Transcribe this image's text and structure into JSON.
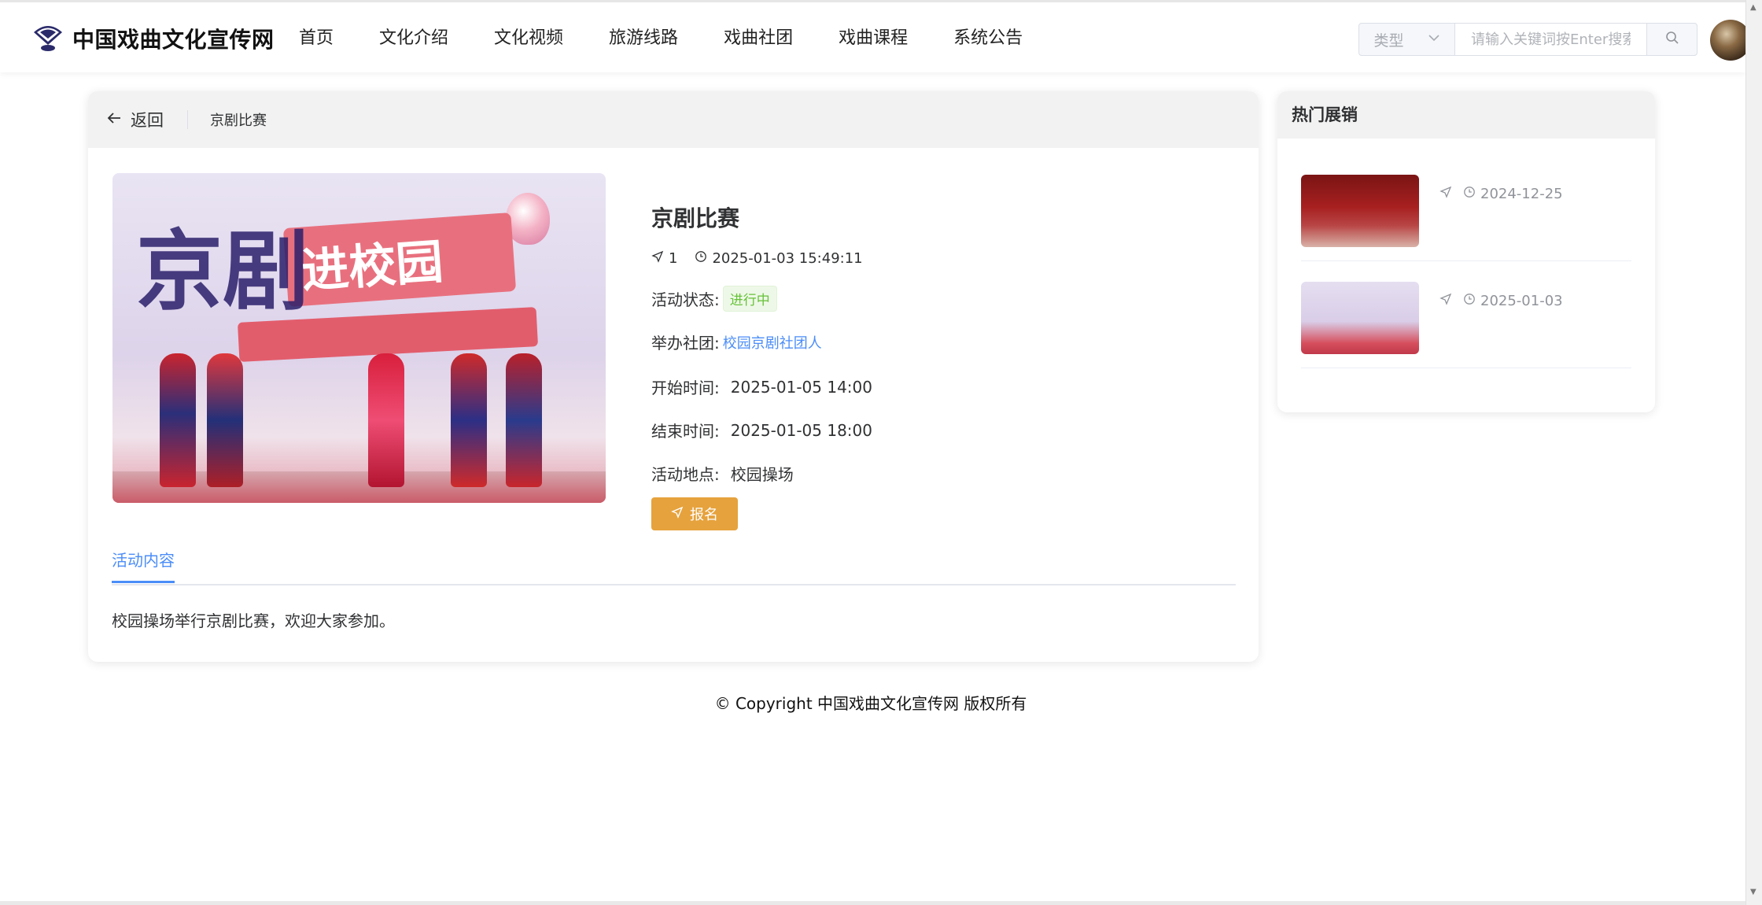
{
  "header": {
    "site_title": "中国戏曲文化宣传网",
    "logo_icon": "fan-icon",
    "nav": [
      {
        "label": "首页"
      },
      {
        "label": "文化介绍"
      },
      {
        "label": "文化视频"
      },
      {
        "label": "旅游线路"
      },
      {
        "label": "戏曲社团"
      },
      {
        "label": "戏曲课程"
      },
      {
        "label": "系统公告"
      }
    ],
    "search": {
      "type_placeholder": "类型",
      "placeholder": "请输入关键词按Enter搜索"
    }
  },
  "detail": {
    "back_label": "返回",
    "breadcrumb": "京剧比赛",
    "title": "京剧比赛",
    "participants": "1",
    "datetime": "2025-01-03 15:49:11",
    "status_label": "活动状态:",
    "status_value": "进行中",
    "club_label": "举办社团:",
    "club_value": "校园京剧社团人",
    "start_label": "开始时间:",
    "start_value": "2025-01-05 14:00",
    "end_label": "结束时间:",
    "end_value": "2025-01-05 18:00",
    "place_label": "活动地点:",
    "place_value": "校园操场",
    "signup_label": "报名",
    "hero_banner_text": "进校园",
    "hero_big_text": "京剧",
    "tab_label": "活动内容",
    "content": "校园操场举行京剧比赛，欢迎大家参加。"
  },
  "sidebar": {
    "title": "热门展销",
    "items": [
      {
        "date": "2024-12-25"
      },
      {
        "date": "2025-01-03"
      }
    ]
  },
  "footer": {
    "copyright": "© Copyright 中国戏曲文化宣传网 版权所有"
  },
  "colors": {
    "accent": "#4b8df8",
    "status_green": "#67c23a",
    "signup_orange": "#e6a23c"
  }
}
